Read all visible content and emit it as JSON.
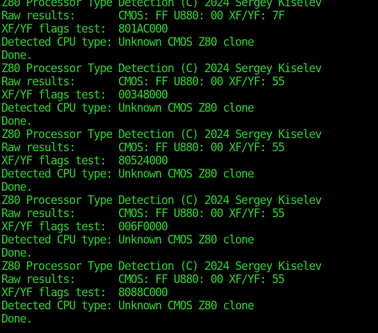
{
  "colors": {
    "background": "#000000",
    "text": "#2ed12e"
  },
  "lines": [
    "Z80 Processor Type Detection (C) 2024 Sergey Kiselev",
    "Raw results:       CMOS: FF U880: 00 XF/YF: 7F",
    "XF/YF flags test:  801AC000",
    "Detected CPU type: Unknown CMOS Z80 clone",
    "Done.",
    "Z80 Processor Type Detection (C) 2024 Sergey Kiselev",
    "Raw results:       CMOS: FF U880: 00 XF/YF: 55",
    "XF/YF flags test:  00348000",
    "Detected CPU type: Unknown CMOS Z80 clone",
    "Done.",
    "Z80 Processor Type Detection (C) 2024 Sergey Kiselev",
    "Raw results:       CMOS: FF U880: 00 XF/YF: 55",
    "XF/YF flags test:  80524000",
    "Detected CPU type: Unknown CMOS Z80 clone",
    "Done.",
    "Z80 Processor Type Detection (C) 2024 Sergey Kiselev",
    "Raw results:       CMOS: FF U880: 00 XF/YF: 55",
    "XF/YF flags test:  006F0000",
    "Detected CPU type: Unknown CMOS Z80 clone",
    "Done.",
    "Z80 Processor Type Detection (C) 2024 Sergey Kiselev",
    "Raw results:       CMOS: FF U880: 00 XF/YF: 55",
    "XF/YF flags test:  8088C000",
    "Detected CPU type: Unknown CMOS Z80 clone",
    "Done."
  ]
}
